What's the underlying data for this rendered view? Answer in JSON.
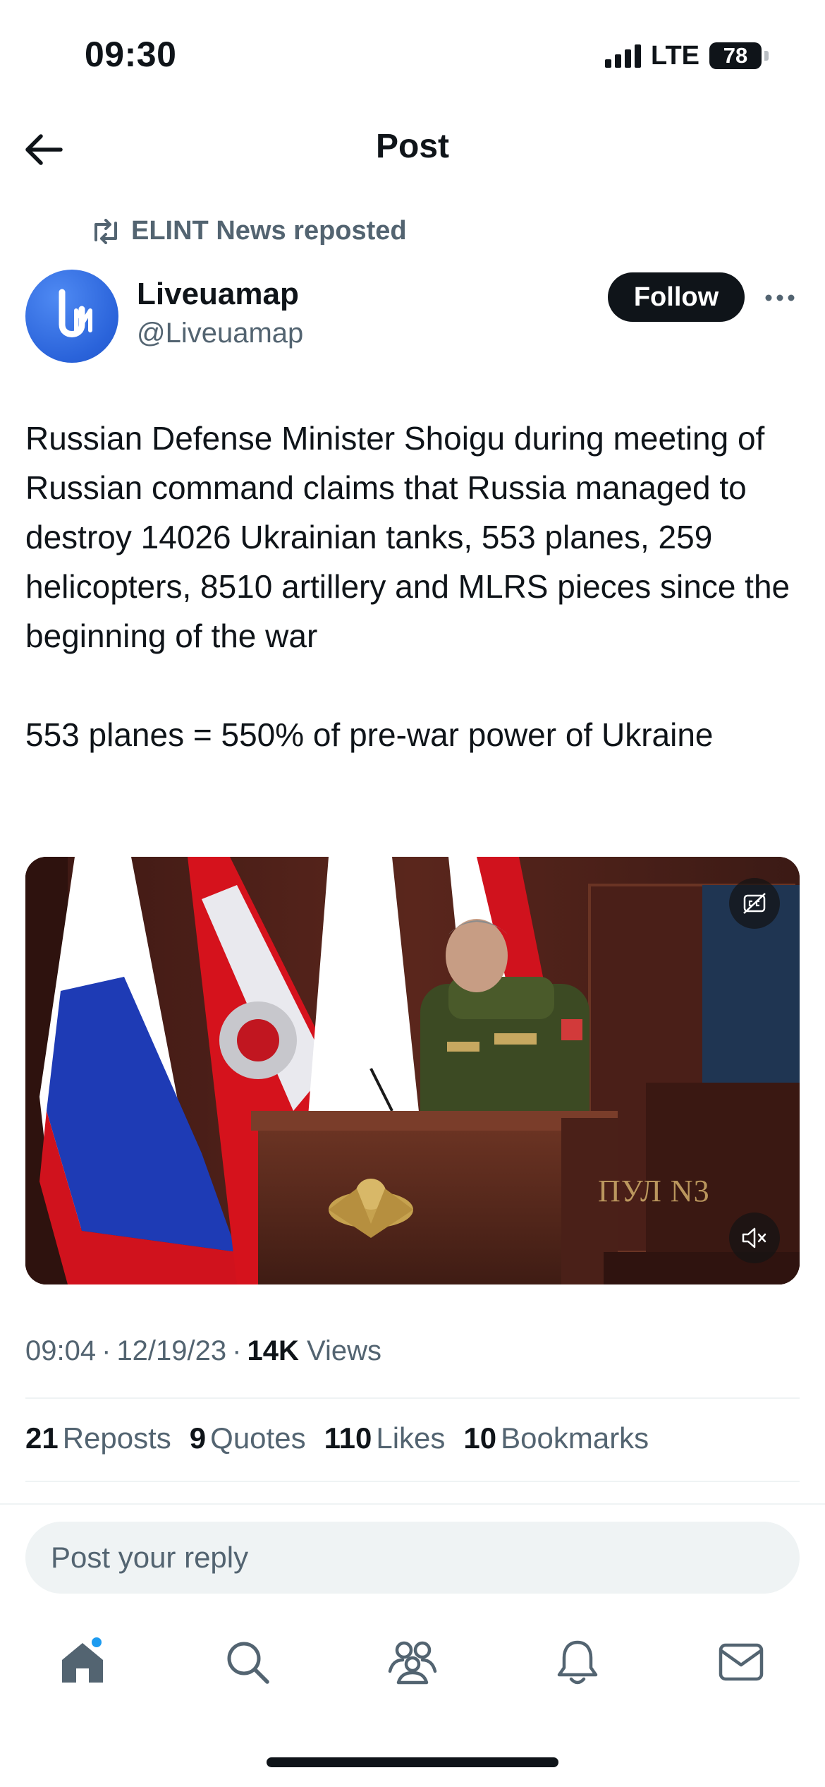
{
  "status_bar": {
    "time": "09:30",
    "network": "LTE",
    "battery": "78"
  },
  "header": {
    "title": "Post"
  },
  "repost": {
    "text": "ELINT News reposted"
  },
  "author": {
    "name": "Liveuamap",
    "handle": "@Liveuamap",
    "follow_label": "Follow"
  },
  "post": {
    "paragraph_1": "Russian Defense Minister Shoigu during meeting of Russian command claims that Russia managed to destroy 14026 Ukrainian tanks, 553 planes, 259 helicopters, 8510 artillery and MLRS pieces since the beginning of the war",
    "paragraph_2": "553 planes = 550% of pre-war power of Ukraine"
  },
  "video": {
    "watermark": "ПУЛ N3"
  },
  "meta": {
    "time": "09:04",
    "date": "12/19/23",
    "views_count": "14K",
    "views_label": "Views",
    "separator": "·"
  },
  "stats": {
    "reposts_count": "21",
    "reposts_label": "Reposts",
    "quotes_count": "9",
    "quotes_label": "Quotes",
    "likes_count": "110",
    "likes_label": "Likes",
    "bookmarks_count": "10",
    "bookmarks_label": "Bookmarks"
  },
  "reply": {
    "placeholder": "Post your reply"
  },
  "tabs": [
    {
      "icon": "home-icon",
      "active": true,
      "has_notification_dot": true
    },
    {
      "icon": "search-icon",
      "active": false
    },
    {
      "icon": "communities-icon",
      "active": false
    },
    {
      "icon": "notifications-icon",
      "active": false
    },
    {
      "icon": "messages-icon",
      "active": false
    }
  ],
  "colors": {
    "text_primary": "#0f1419",
    "text_secondary": "#536471",
    "accent_blue": "#1d9bf0",
    "avatar_blue": "#2a63da",
    "divider": "#eff3f4"
  }
}
